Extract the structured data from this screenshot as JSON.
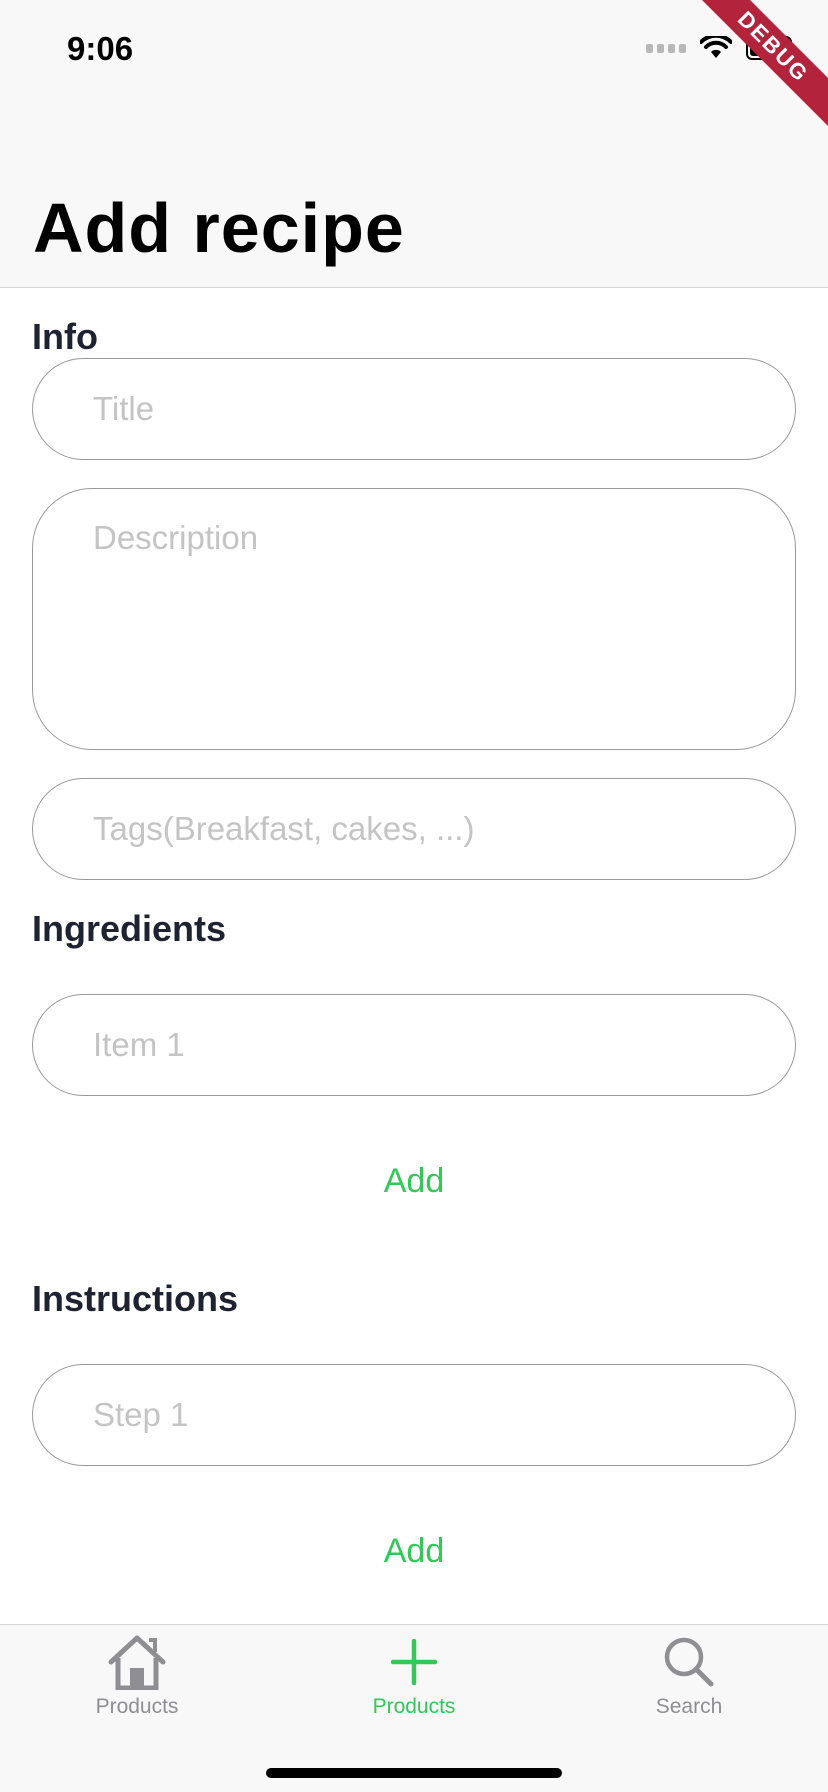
{
  "status_bar": {
    "time": "9:06",
    "debug_banner": "DEBUG"
  },
  "header": {
    "title": "Add recipe"
  },
  "info": {
    "label": "Info",
    "title_placeholder": "Title",
    "description_placeholder": "Description",
    "tags_placeholder": "Tags(Breakfast, cakes, ...)"
  },
  "ingredients": {
    "label": "Ingredients",
    "item_placeholder": "Item 1",
    "add_label": "Add"
  },
  "instructions": {
    "label": "Instructions",
    "step_placeholder": "Step 1",
    "add_label": "Add"
  },
  "tabbar": {
    "items": [
      {
        "label": "Products",
        "icon": "home-icon",
        "active": false
      },
      {
        "label": "Products",
        "icon": "plus-icon",
        "active": true
      },
      {
        "label": "Search",
        "icon": "search-icon",
        "active": false
      }
    ]
  },
  "colors": {
    "accent": "#34c759",
    "inactive": "#8e8e93",
    "placeholder": "#c4c4c4"
  }
}
